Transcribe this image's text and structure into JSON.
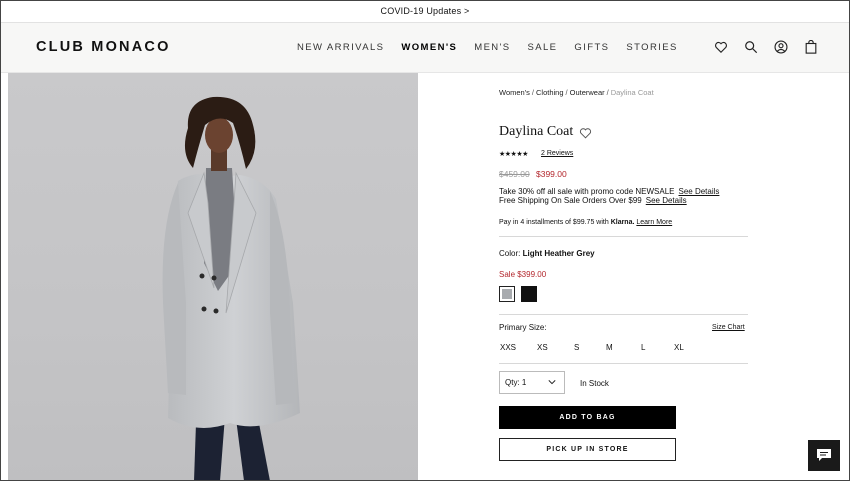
{
  "promo_bar": {
    "text": "COVID-19 Updates >"
  },
  "header": {
    "logo": "CLUB MONACO",
    "nav": [
      "NEW ARRIVALS",
      "WOMEN'S",
      "MEN'S",
      "SALE",
      "GIFTS",
      "STORIES"
    ],
    "active_nav": "WOMEN'S",
    "icons": [
      "heart-icon",
      "search-icon",
      "user-icon",
      "bag-icon"
    ]
  },
  "breadcrumb": {
    "items": [
      "Women's",
      "Clothing",
      "Outerwear"
    ],
    "current": "Daylina Coat",
    "separator": "/"
  },
  "product": {
    "title": "Daylina Coat",
    "rating_stars": "★★★★★",
    "rating_value": 5,
    "reviews_link": "2 Reviews",
    "original_price": "$459.00",
    "sale_price": "$399.00",
    "promo_text": "Take 30% off all sale with promo code NEWSALE",
    "promo_link": "See Details",
    "shipping_text": "Free Shipping On Sale Orders Over $99",
    "shipping_link": "See Details",
    "klarna_prefix": "Pay in 4 installments of $99.75 with",
    "klarna_brand": "Klarna.",
    "klarna_link": "Learn More",
    "color_label": "Color:",
    "color_value": "Light Heather Grey",
    "sale_label": "Sale $399.00",
    "swatches": [
      {
        "name": "Light Heather Grey",
        "color": "#a8abaf",
        "selected": true
      },
      {
        "name": "Black",
        "color": "#111111",
        "selected": false
      }
    ],
    "size_label": "Primary Size:",
    "size_chart_link": "Size Chart",
    "sizes": [
      "XXS",
      "XS",
      "S",
      "M",
      "L",
      "XL"
    ],
    "qty_label": "Qty: 1",
    "stock_status": "In Stock",
    "add_to_bag": "ADD TO BAG",
    "pickup": "PICK UP IN STORE"
  },
  "colors": {
    "sale_red": "#b3272d",
    "button_black": "#000000",
    "header_bg": "#f7f7f6"
  }
}
